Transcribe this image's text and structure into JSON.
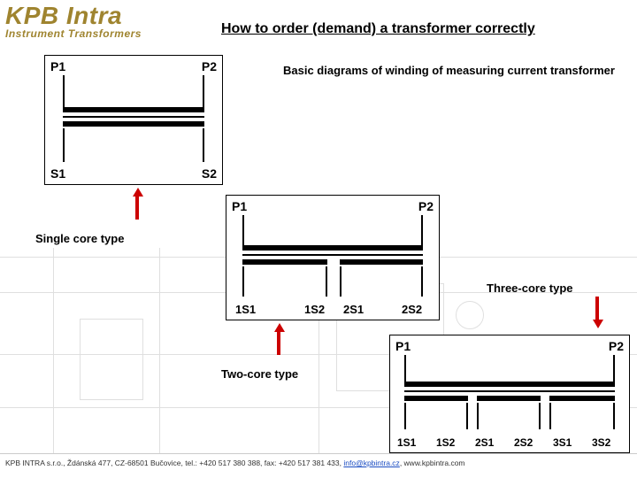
{
  "logo": {
    "line1": "KPB Intra",
    "line2": "Instrument Transformers"
  },
  "title": "How to order (demand) a transformer correctly",
  "section_title": "Basic diagrams of winding of measuring current transformer",
  "captions": {
    "single": "Single core type",
    "two": "Two-core type",
    "three": "Three-core type"
  },
  "diagrams": {
    "single": {
      "p1": "P1",
      "p2": "P2",
      "s1": "S1",
      "s2": "S2"
    },
    "two": {
      "p1": "P1",
      "p2": "P2",
      "s": [
        "1S1",
        "1S2",
        "2S1",
        "2S2"
      ]
    },
    "three": {
      "p1": "P1",
      "p2": "P2",
      "s": [
        "1S1",
        "1S2",
        "2S1",
        "2S2",
        "3S1",
        "3S2"
      ]
    }
  },
  "footer": {
    "company": "KPB INTRA s.r.o.",
    "address": "Ždánská 477, CZ-68501 Bučovice",
    "tel_label": "tel.:",
    "tel": "+420 517 380 388",
    "fax_label": "fax:",
    "fax": "+420 517 381 433",
    "email": "info@kpbintra.cz",
    "web": "www.kpbintra.com"
  }
}
